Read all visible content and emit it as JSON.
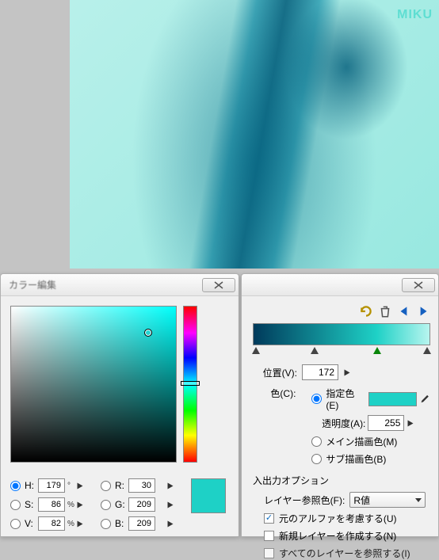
{
  "artwork": {
    "label": "MIKU"
  },
  "picker": {
    "title": "カラー編集",
    "hsv": {
      "h": {
        "label": "H:",
        "value": "179",
        "unit": "°"
      },
      "s": {
        "label": "S:",
        "value": "86",
        "unit": "%"
      },
      "v": {
        "label": "V:",
        "value": "82",
        "unit": "%"
      }
    },
    "rgb": {
      "r": {
        "label": "R:",
        "value": "30"
      },
      "g": {
        "label": "G:",
        "value": "209"
      },
      "b": {
        "label": "B:",
        "value": "209"
      }
    },
    "selected_mode": "H"
  },
  "grad": {
    "gradient_stops": [
      0,
      35,
      70,
      100
    ],
    "active_stop": 70,
    "position": {
      "label": "位置(V):",
      "value": "172"
    },
    "color": {
      "label": "色(C):",
      "options": {
        "specified": "指定色(E)",
        "main": "メイン描画色(M)",
        "sub": "サブ描画色(B)"
      },
      "selected": "specified"
    },
    "opacity": {
      "label": "透明度(A):",
      "value": "255"
    },
    "io_section": "入出力オプション",
    "layer_ref": {
      "label": "レイヤー参照色(F):",
      "value": "R値"
    },
    "keep_alpha": {
      "label": "元のアルファを考慮する(U)",
      "checked": true
    },
    "new_layer": {
      "label": "新規レイヤーを作成する(N)",
      "checked": false
    },
    "ref_all": {
      "label": "すべてのレイヤーを参照する(I)"
    }
  }
}
